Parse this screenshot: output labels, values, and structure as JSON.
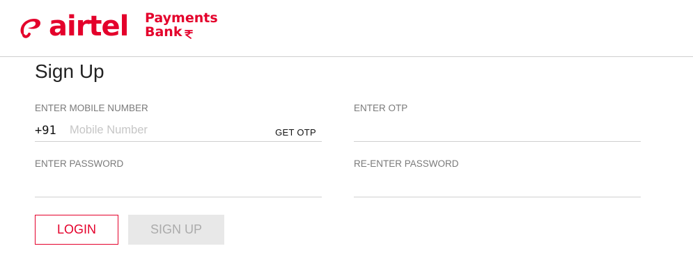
{
  "brand": {
    "name": "airtel",
    "sub_line1": "Payments",
    "sub_line2": "Bank",
    "color": "#e4002b"
  },
  "form": {
    "title": "Sign Up",
    "mobile": {
      "label": "ENTER MOBILE NUMBER",
      "prefix": "+91",
      "placeholder": "Mobile Number",
      "value": "",
      "action_label": "GET OTP"
    },
    "otp": {
      "label": "ENTER OTP",
      "value": ""
    },
    "password": {
      "label": "ENTER PASSWORD",
      "value": ""
    },
    "confirm_password": {
      "label": "RE-ENTER PASSWORD",
      "value": ""
    }
  },
  "buttons": {
    "login_label": "LOGIN",
    "signup_label": "SIGN UP"
  }
}
